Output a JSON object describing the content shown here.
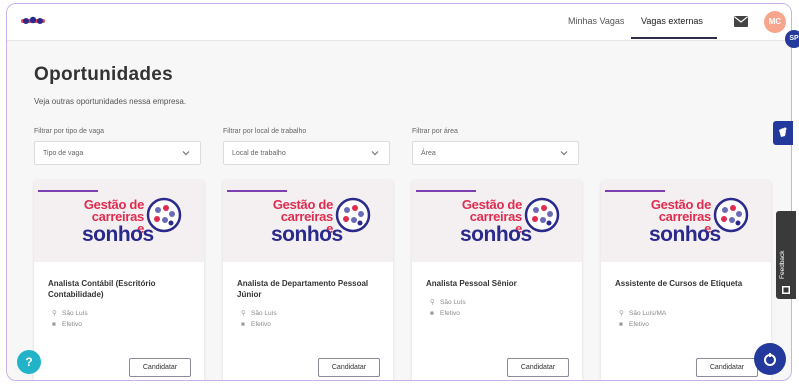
{
  "topbar": {
    "nav": [
      {
        "label": "Minhas Vagas",
        "active": false
      },
      {
        "label": "Vagas externas",
        "active": true
      }
    ],
    "avatar_initials": "MC",
    "badge": "SP",
    "accent": "#2d2d4a"
  },
  "page": {
    "title": "Oportunidades",
    "subtitle": "Veja outras oportunidades nessa empresa."
  },
  "filters": [
    {
      "label": "Filtrar por tipo de vaga",
      "value": "Tipo de vaga"
    },
    {
      "label": "Filtrar por local de trabalho",
      "value": "Local de trabalho"
    },
    {
      "label": "Filtrar por área",
      "value": "Área"
    }
  ],
  "banner": {
    "line1": "Gestão de",
    "line2": "carreiras e",
    "line3": "sonhos"
  },
  "cards": [
    {
      "title": "Analista Contábil (Escritório Contabilidade)",
      "location": "São Luís",
      "type": "Efetivo",
      "button": "Candidatar"
    },
    {
      "title": "Analista de Departamento Pessoal Júnior",
      "location": "São Luís",
      "type": "Efetivo",
      "button": "Candidatar"
    },
    {
      "title": "Analista Pessoal Sênior",
      "location": "São Luís",
      "type": "Efetivo",
      "button": "Candidatar"
    },
    {
      "title": "Assistente de Cursos de Etiqueta",
      "location": "São Luís/MA",
      "type": "Efetivo",
      "button": "Candidatar"
    }
  ],
  "widgets": {
    "feedback_label": "Feedback",
    "help_label": "?"
  }
}
